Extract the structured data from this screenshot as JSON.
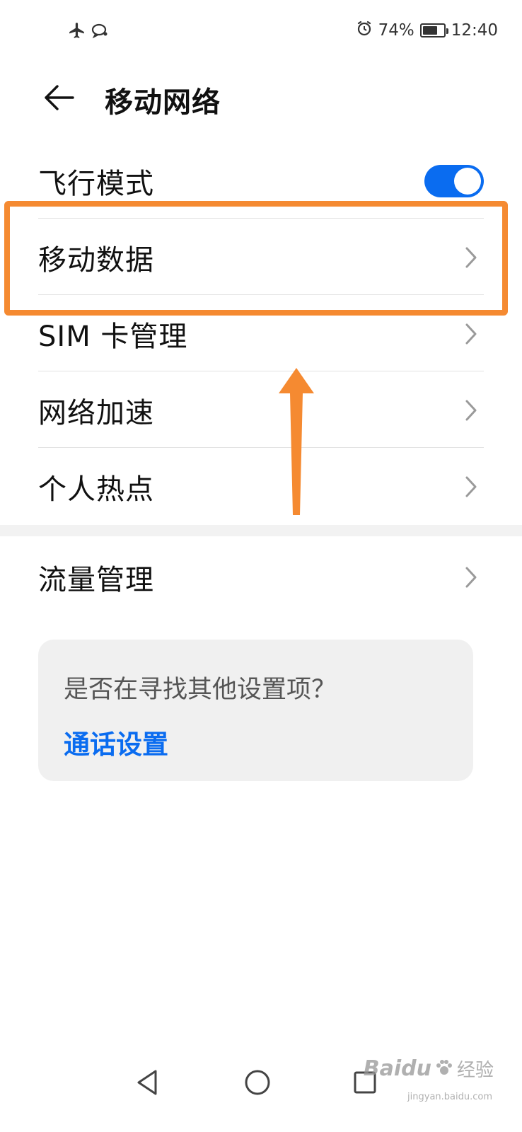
{
  "status_bar": {
    "icons": [
      "airplane-icon",
      "chat-bubble-icon"
    ],
    "alarm_icon": "alarm-icon",
    "battery_percent": "74%",
    "battery_level": 0.74,
    "time": "12:40"
  },
  "header": {
    "back_icon": "back-arrow-icon",
    "title": "移动网络"
  },
  "settings": [
    {
      "label": "飞行模式",
      "control": "toggle",
      "toggle_on": true
    },
    {
      "label": "移动数据",
      "control": "chevron"
    },
    {
      "label": "SIM 卡管理",
      "control": "chevron"
    },
    {
      "label": "网络加速",
      "control": "chevron"
    },
    {
      "label": "个人热点",
      "control": "chevron"
    }
  ],
  "settings_group2": [
    {
      "label": "流量管理",
      "control": "chevron"
    }
  ],
  "hint_card": {
    "question": "是否在寻找其他设置项？",
    "link": "通话设置"
  },
  "annotation": {
    "highlight_color": "#f58a31",
    "highlighted_item": "移动数据"
  },
  "colors": {
    "accent": "#0a6cf0",
    "annotation": "#f58a31"
  },
  "navigation": {
    "back": "nav-back-triangle-icon",
    "home": "nav-home-circle-icon",
    "recents": "nav-recents-square-icon"
  },
  "watermark": {
    "brand": "Baidu",
    "cn": "经验",
    "url": "jingyan.baidu.com"
  }
}
